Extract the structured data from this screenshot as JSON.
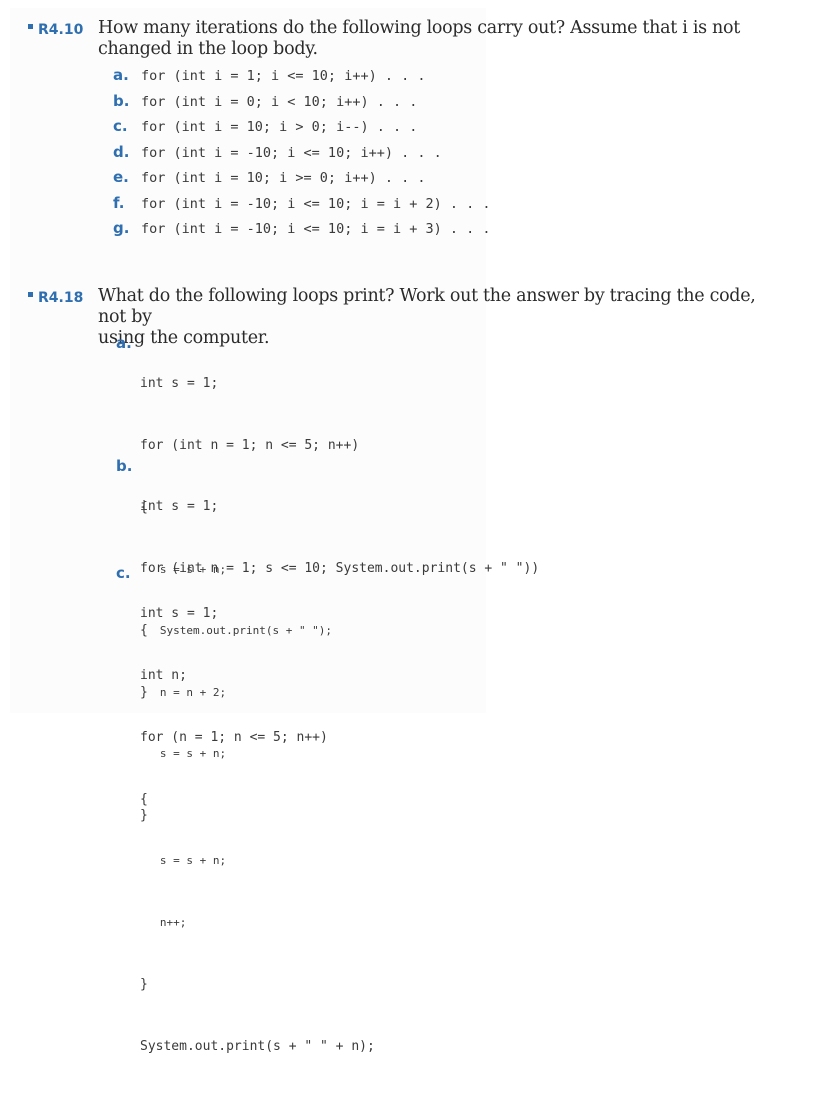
{
  "exercises": [
    {
      "number": "R4.10",
      "prompt_line1": "How many iterations do the following loops carry out? Assume that i is not",
      "prompt_line2": "changed in the loop body.",
      "items": [
        {
          "letter": "a.",
          "code": "for (int i = 1; i <= 10; i++) . . ."
        },
        {
          "letter": "b.",
          "code": "for (int i = 0; i < 10; i++) . . ."
        },
        {
          "letter": "c.",
          "code": "for (int i = 10; i > 0; i--) . . ."
        },
        {
          "letter": "d.",
          "code": "for (int i = -10; i <= 10; i++) . . ."
        },
        {
          "letter": "e.",
          "code": "for (int i = 10; i >= 0; i++) . . ."
        },
        {
          "letter": "f.",
          "code": "for (int i = -10; i <= 10; i = i + 2) . . ."
        },
        {
          "letter": "g.",
          "code": "for (int i = -10; i <= 10; i = i + 3) . . ."
        }
      ]
    },
    {
      "number": "R4.18",
      "prompt_line1": "What do the following loops print? Work out the answer by tracing the code, not by",
      "prompt_line2": "using the computer.",
      "parts": [
        {
          "letter": "a.",
          "lines": [
            "int s = 1;",
            "for (int n = 1; n <= 5; n++)",
            "{",
            "   s = s + n;",
            "   System.out.print(s + \" \");",
            "}"
          ]
        },
        {
          "letter": "b.",
          "lines": [
            "int s = 1;",
            "for (int n = 1; s <= 10; System.out.print(s + \" \"))",
            "{",
            "   n = n + 2;",
            "   s = s + n;",
            "}"
          ]
        },
        {
          "letter": "c.",
          "lines": [
            "int s = 1;",
            "int n;",
            "for (n = 1; n <= 5; n++)",
            "{",
            "   s = s + n;",
            "   n++;",
            "}",
            "System.out.print(s + \" \" + n);"
          ]
        }
      ]
    }
  ],
  "colors": {
    "accent": "#2f6fb0",
    "text": "#2a2a2a",
    "code": "#3a3a3a"
  }
}
